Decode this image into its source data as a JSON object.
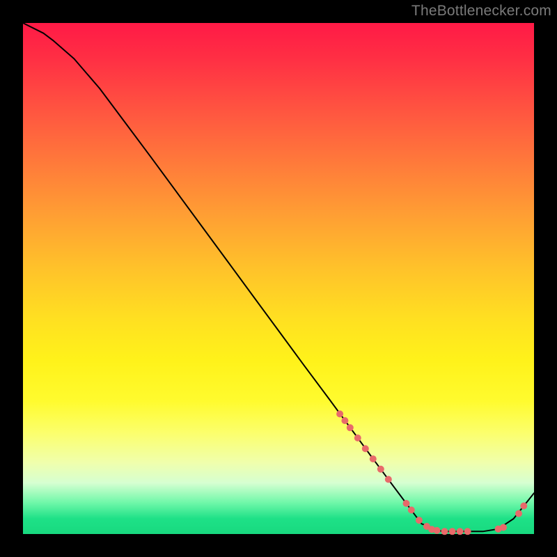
{
  "attribution": "TheBottlenecker.com",
  "chart_data": {
    "type": "line",
    "title": "",
    "xlabel": "",
    "ylabel": "",
    "xlim": [
      0,
      100
    ],
    "ylim": [
      0,
      100
    ],
    "x": [
      0,
      4,
      6,
      10,
      15,
      20,
      25,
      30,
      35,
      40,
      45,
      50,
      55,
      60,
      65,
      68,
      70,
      72,
      75,
      78,
      82,
      86,
      90,
      93,
      96,
      98,
      100
    ],
    "values": [
      100,
      98,
      96.5,
      93,
      87.2,
      80.5,
      73.8,
      67.0,
      60.2,
      53.4,
      46.6,
      39.8,
      33.0,
      26.3,
      19.5,
      15.4,
      12.7,
      10.0,
      6.0,
      2.0,
      0.5,
      0.5,
      0.5,
      1.0,
      3.0,
      5.5,
      8.0
    ],
    "marker_points": {
      "x": [
        62,
        63,
        64,
        65.5,
        67,
        68.5,
        70,
        71.5,
        75,
        76,
        77.5,
        79,
        80,
        81,
        82.5,
        84,
        85.5,
        87,
        93,
        94,
        97,
        98
      ],
      "y": [
        23.5,
        22.2,
        20.8,
        18.8,
        16.7,
        14.7,
        12.7,
        10.7,
        6.0,
        4.7,
        2.7,
        1.5,
        0.9,
        0.7,
        0.5,
        0.5,
        0.5,
        0.5,
        1.0,
        1.3,
        4.0,
        5.5
      ]
    },
    "background": {
      "type": "vertical-gradient",
      "stops": [
        {
          "pos": 0.0,
          "color": "#ff1a46"
        },
        {
          "pos": 0.5,
          "color": "#ffd024"
        },
        {
          "pos": 0.8,
          "color": "#fcff6a"
        },
        {
          "pos": 1.0,
          "color": "#18d97f"
        }
      ]
    }
  }
}
